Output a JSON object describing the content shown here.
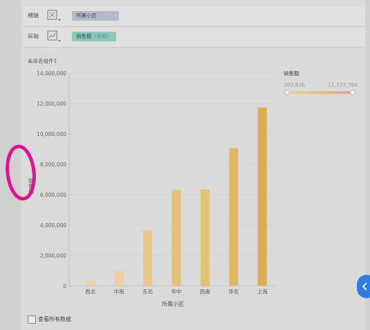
{
  "shelves": {
    "x_axis": {
      "label": "横轴",
      "pill": "所属小区",
      "icon": "bar-chart-type-icon"
    },
    "y_axis": {
      "label": "纵轴",
      "pill": "销售额",
      "pill_agg": "(求和)",
      "icon": "line-chart-type-icon"
    }
  },
  "chart_title": "未命名组件1",
  "legend": {
    "title": "销售额",
    "min": "393,836",
    "max": "11,737,794"
  },
  "footer": {
    "show_all_label": "查看所有数据"
  },
  "colors": {
    "bar_low": "#ecd3a4",
    "bar_high": "#ddae50",
    "annotation": "#e0138c",
    "accent": "#2f7de0"
  },
  "chart_data": {
    "type": "bar",
    "title": "未命名组件1",
    "xlabel": "所属小区",
    "ylabel": "销售额",
    "categories": [
      "西北",
      "中南",
      "东北",
      "华中",
      "西南",
      "华北",
      "上海"
    ],
    "values": [
      393836,
      1000000,
      3650000,
      6320000,
      6350000,
      9050000,
      11737794
    ],
    "ylim": [
      0,
      14000000
    ],
    "yticks": [
      0,
      2000000,
      4000000,
      6000000,
      8000000,
      10000000,
      12000000,
      14000000
    ],
    "ytick_labels": [
      "0",
      "2,000,000",
      "4,000,000",
      "6,000,000",
      "8,000,000",
      "10,000,000",
      "12,000,000",
      "14,000,000"
    ],
    "grid": true,
    "legend_position": "top-right"
  }
}
